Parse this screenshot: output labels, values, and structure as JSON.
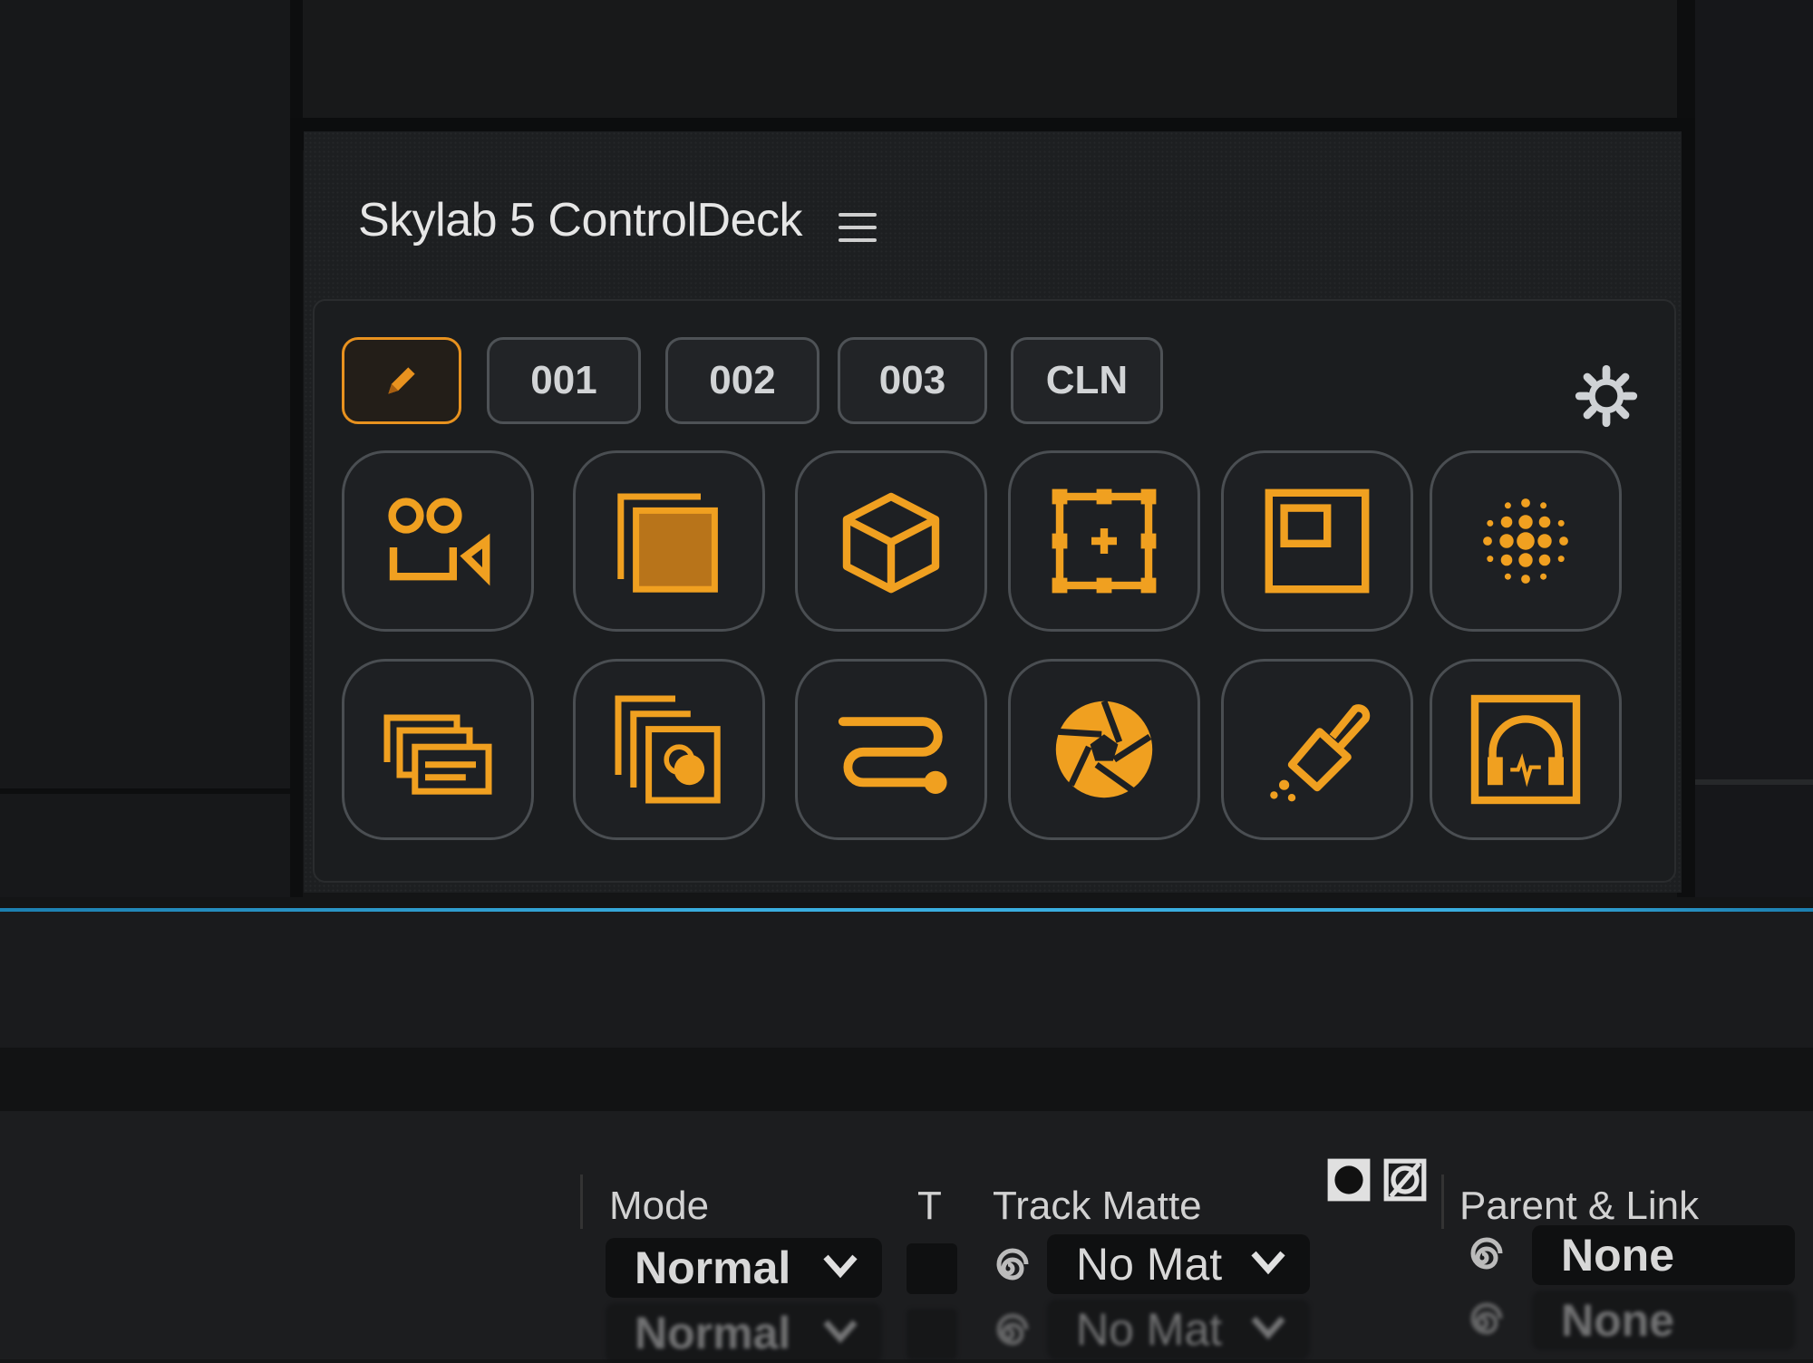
{
  "panel": {
    "title": "Skylab 5 ControlDeck",
    "menu_icon": "hamburger-menu-icon",
    "tabs": [
      {
        "label": "",
        "icon": "pencil-icon",
        "active": true
      },
      {
        "label": "001",
        "active": false
      },
      {
        "label": "002",
        "active": false
      },
      {
        "label": "003",
        "active": false
      },
      {
        "label": "CLN",
        "active": false
      }
    ],
    "settings_icon": "gear-icon",
    "accent_color": "#e8921f",
    "buttons": [
      "camera-icon",
      "solid-layer-icon",
      "3d-cube-icon",
      "null-object-icon",
      "precomp-icon",
      "halftone-dots-icon",
      "stacked-cards-icon",
      "layer-stack-icon",
      "motion-path-icon",
      "aperture-icon",
      "cleanup-brush-icon",
      "audio-headphones-icon"
    ]
  },
  "timeline": {
    "headers": {
      "mode": "Mode",
      "t": "T",
      "track_matte": "Track Matte",
      "parent_link": "Parent & Link"
    },
    "rows": [
      {
        "mode": "Normal",
        "matte": "No Mat",
        "parent": "None"
      },
      {
        "mode": "Normal",
        "matte": "No Mat",
        "parent": "None"
      }
    ]
  }
}
